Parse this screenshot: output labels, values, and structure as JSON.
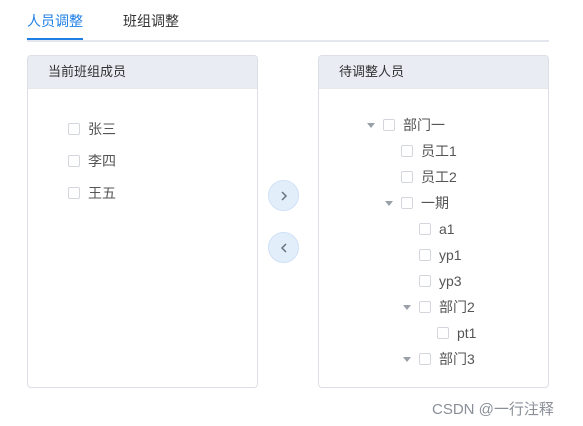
{
  "tabs": [
    {
      "label": "人员调整",
      "active": true
    },
    {
      "label": "班组调整",
      "active": false
    }
  ],
  "left_panel": {
    "title": "当前班组成员",
    "members": [
      "张三",
      "李四",
      "王五"
    ]
  },
  "transfer": {
    "right_icon": "chevron-right-icon",
    "left_icon": "chevron-left-icon"
  },
  "right_panel": {
    "title": "待调整人员",
    "tree": [
      {
        "label": "部门一",
        "level": 0,
        "expandable": true
      },
      {
        "label": "员工1",
        "level": 1,
        "expandable": false
      },
      {
        "label": "员工2",
        "level": 1,
        "expandable": false
      },
      {
        "label": "一期",
        "level": 1,
        "expandable": true
      },
      {
        "label": "a1",
        "level": 2,
        "expandable": false
      },
      {
        "label": "yp1",
        "level": 2,
        "expandable": false
      },
      {
        "label": "yp3",
        "level": 2,
        "expandable": false
      },
      {
        "label": "部门2",
        "level": 2,
        "expandable": true
      },
      {
        "label": "pt1",
        "level": 3,
        "expandable": false
      },
      {
        "label": "部门3",
        "level": 2,
        "expandable": true
      }
    ]
  },
  "watermark": "CSDN @一行注释",
  "colors": {
    "accent": "#1f7fe5",
    "header_bg": "#e9ecf2",
    "arrow_bg": "#e3eefb"
  }
}
